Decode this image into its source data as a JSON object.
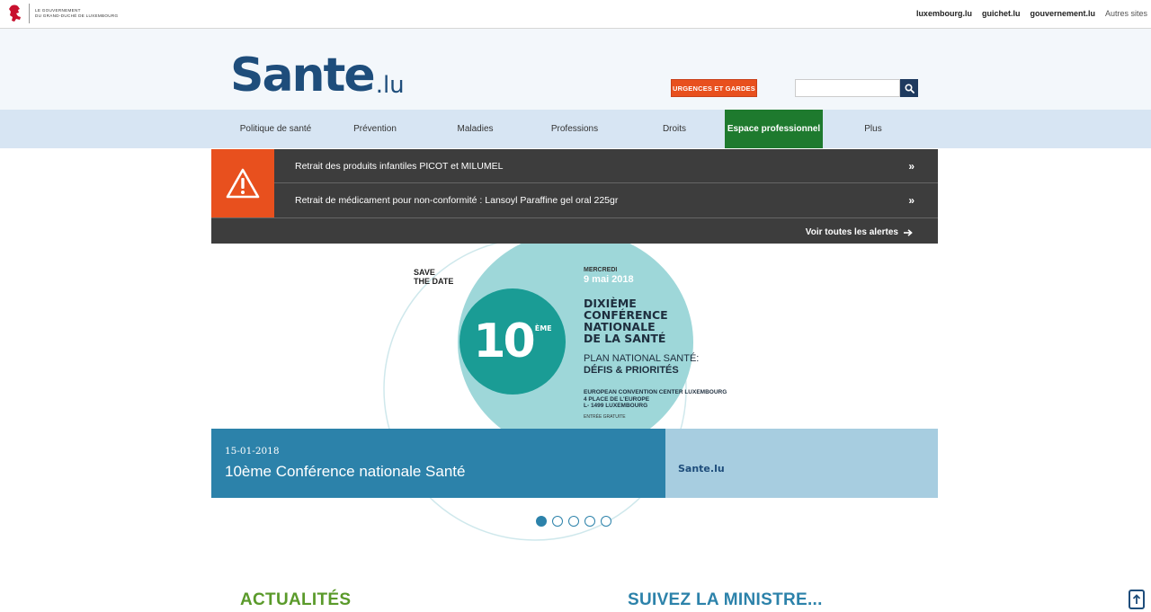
{
  "gov_bar": {
    "logo_text_line1": "Le gouvernement",
    "logo_text_line2": "du Grand-Duché de Luxembourg",
    "links": [
      "luxembourg.lu",
      "guichet.lu",
      "gouvernement.lu"
    ],
    "other_sites": "Autres sites"
  },
  "header": {
    "logo_main": "Sante",
    "logo_suffix": ".lu",
    "urgences_label": "URGENCES ET GARDES",
    "search_value": ""
  },
  "nav": {
    "items": [
      {
        "label": "Politique de santé"
      },
      {
        "label": "Prévention"
      },
      {
        "label": "Maladies"
      },
      {
        "label": "Professions"
      },
      {
        "label": "Droits"
      },
      {
        "label": "Espace professionnel"
      },
      {
        "label": "Plus"
      }
    ],
    "active_index": 5
  },
  "alerts": {
    "items": [
      {
        "text": "Retrait des produits infantiles PICOT et MILUMEL"
      },
      {
        "text": "Retrait de médicament pour non-conformité : Lansoyl Paraffine gel oral 225gr"
      }
    ],
    "all_label": "Voir toutes les alertes"
  },
  "carousel": {
    "save_date_line1": "SAVE",
    "save_date_line2": "THE DATE",
    "ten_number": "10",
    "ten_sup": "ÈME",
    "day": "MERCREDI",
    "date": "9 mai 2018",
    "conf_line1": "DIXIÈME",
    "conf_line2": "CONFÉRENCE",
    "conf_line3": "NATIONALE",
    "conf_line4": "DE LA SANTÉ",
    "plan_line1": "PLAN NATIONAL SANTÉ:",
    "plan_line2": "DÉFIS & PRIORITÉS",
    "address_line1": "EUROPEAN CONVENTION CENTER LUXEMBOURG",
    "address_line2": "4 PLACE DE L'EUROPE",
    "address_line3": "L- 1499 LUXEMBOURG",
    "entree": "ENTRÉE GRATUITE",
    "caption_date": "15-01-2018",
    "caption_title": "10ème Conférence nationale Santé",
    "caption_logo": "Sante.lu",
    "slide_count": 5,
    "active_slide": 0
  },
  "sections": {
    "left_title": "ACTUALITÉS",
    "right_title": "SUIVEZ LA MINISTRE..."
  },
  "colors": {
    "brand_blue": "#1e4d7b",
    "accent_orange": "#e8501e",
    "active_green": "#1e7a2e",
    "teal": "#2c82aa"
  }
}
